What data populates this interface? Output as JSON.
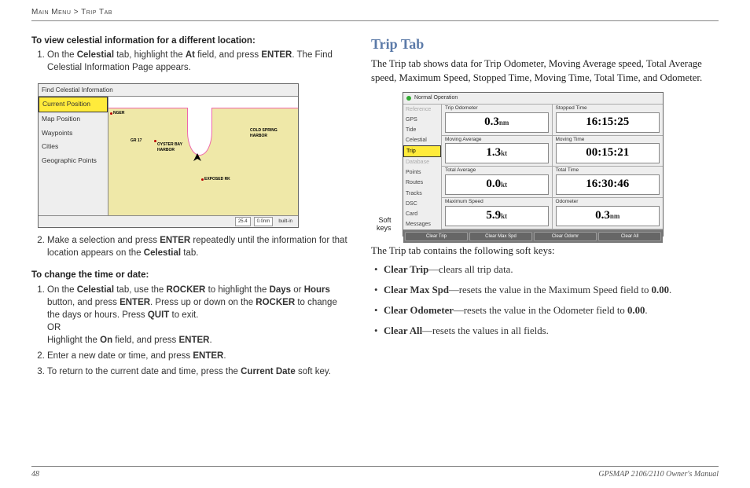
{
  "breadcrumb": {
    "a": "Main Menu",
    "sep": ">",
    "b": "Trip Tab"
  },
  "left": {
    "hdr1": "To view celestial information for a different location:",
    "step1a": "On the ",
    "step1b": "Celestial",
    "step1c": " tab, highlight the ",
    "step1d": "At",
    "step1e": " field, and press ",
    "step1f": "ENTER",
    "step1g": ". The Find Celestial Information Page appears.",
    "celestial": {
      "title": "Find Celestial Information",
      "items": [
        "Current Position",
        "Map Position",
        "Waypoints",
        "Cities",
        "Geographic Points"
      ],
      "map_labels": {
        "a": "NGER",
        "b": "OYSTER BAY HARBOR",
        "c": "COLD SPRING HARBOR",
        "d": "EXPOSED RK",
        "e": "GR 17"
      },
      "status": {
        "a": "25.4",
        "b": "0.0nm",
        "c": "built-in"
      }
    },
    "step2a": "Make a selection and press ",
    "step2b": "ENTER",
    "step2c": " repeatedly until the information for that location appears on the ",
    "step2d": "Celestial",
    "step2e": " tab.",
    "hdr2": "To change the time or date:",
    "s2_1a": "On the ",
    "s2_1b": "Celestial",
    "s2_1c": " tab, use the ",
    "s2_1d": "ROCKER",
    "s2_1e": " to highlight the ",
    "s2_1f": "Days",
    "s2_1g": " or ",
    "s2_1h": "Hours",
    "s2_1i": " button, and press ",
    "s2_1j": "ENTER",
    "s2_1k": ". Press up or down on the ",
    "s2_1l": "ROCKER",
    "s2_1m": " to change the days or hours. Press ",
    "s2_1n": "QUIT",
    "s2_1o": " to exit.",
    "s2_or": "OR",
    "s2_alt_a": "Highlight the ",
    "s2_alt_b": "On",
    "s2_alt_c": " field, and press ",
    "s2_alt_d": "ENTER",
    "s2_alt_e": ".",
    "s2_2a": "Enter a new date or time, and press ",
    "s2_2b": "ENTER",
    "s2_2c": ".",
    "s2_3a": "To return to the current date and time, press the ",
    "s2_3b": "Current Date",
    "s2_3c": " soft key."
  },
  "right": {
    "title": "Trip Tab",
    "intro": "The Trip tab shows data for Trip Odometer, Moving Average speed, Total Average speed, Maximum Speed, Stopped Time, Moving Time, Total Time, and Odometer.",
    "fig": {
      "title": "Normal Operation",
      "tabs": [
        "Reference",
        "GPS",
        "Tide",
        "Celestial",
        "Trip",
        "Database",
        "Points",
        "Routes",
        "Tracks",
        "DSC",
        "Card",
        "Messages"
      ],
      "cells": [
        {
          "lbl": "Trip Odometer",
          "num": "0.3",
          "unit": "nm"
        },
        {
          "lbl": "Stopped Time",
          "num": "16:15:25",
          "unit": ""
        },
        {
          "lbl": "Moving Average",
          "num": "1.3",
          "unit": "kt"
        },
        {
          "lbl": "Moving Time",
          "num": "00:15:21",
          "unit": ""
        },
        {
          "lbl": "Total Average",
          "num": "0.0",
          "unit": "kt"
        },
        {
          "lbl": "Total Time",
          "num": "16:30:46",
          "unit": ""
        },
        {
          "lbl": "Maximum Speed",
          "num": "5.9",
          "unit": "kt"
        },
        {
          "lbl": "Odometer",
          "num": "0.3",
          "unit": "nm"
        }
      ],
      "softkeys": [
        "Clear Trip",
        "Clear Max Spd",
        "Clear Odomr",
        "Clear All"
      ],
      "softkeys_label1": "Soft",
      "softkeys_label2": "keys"
    },
    "soft_intro": "The Trip tab contains the following soft keys:",
    "bullets": [
      {
        "a": "Clear Trip",
        "b": "—clears all trip data."
      },
      {
        "a": "Clear Max Spd",
        "b": "—resets the value in the Maximum Speed field to ",
        "c": "0.00",
        "d": "."
      },
      {
        "a": "Clear Odometer",
        "b": "—resets the value in the Odometer field to ",
        "c": "0.00",
        "d": "."
      },
      {
        "a": "Clear All",
        "b": "—resets the values in all fields."
      }
    ]
  },
  "footer": {
    "page": "48",
    "manual": "GPSMAP 2106/2110 Owner's Manual"
  }
}
